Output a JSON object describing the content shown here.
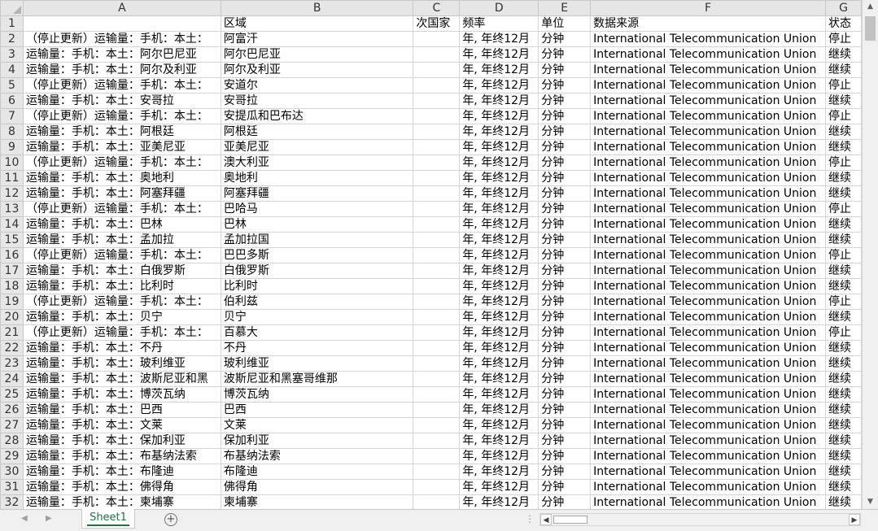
{
  "columns": [
    "A",
    "B",
    "C",
    "D",
    "E",
    "F",
    "G"
  ],
  "header_row": {
    "num": "1",
    "cells": [
      "",
      "区域",
      "次国家",
      "频率",
      "单位",
      "数据来源",
      "状态"
    ]
  },
  "rows": [
    {
      "num": "2",
      "cells": [
        "（停止更新）运输量：手机：本土：",
        "阿富汗",
        "",
        "年, 年终12月",
        "分钟",
        "International Telecommunication Union",
        "停止"
      ]
    },
    {
      "num": "3",
      "cells": [
        "运输量：手机：本土：阿尔巴尼亚",
        "阿尔巴尼亚",
        "",
        "年, 年终12月",
        "分钟",
        "International Telecommunication Union",
        "继续"
      ]
    },
    {
      "num": "4",
      "cells": [
        "运输量：手机：本土：阿尔及利亚",
        "阿尔及利亚",
        "",
        "年, 年终12月",
        "分钟",
        "International Telecommunication Union",
        "继续"
      ]
    },
    {
      "num": "5",
      "cells": [
        "（停止更新）运输量：手机：本土：",
        "安道尔",
        "",
        "年, 年终12月",
        "分钟",
        "International Telecommunication Union",
        "停止"
      ]
    },
    {
      "num": "6",
      "cells": [
        "运输量：手机：本土：安哥拉",
        "安哥拉",
        "",
        "年, 年终12月",
        "分钟",
        "International Telecommunication Union",
        "继续"
      ]
    },
    {
      "num": "7",
      "cells": [
        "（停止更新）运输量：手机：本土：",
        "安提瓜和巴布达",
        "",
        "年, 年终12月",
        "分钟",
        "International Telecommunication Union",
        "停止"
      ]
    },
    {
      "num": "8",
      "cells": [
        "运输量：手机：本土：阿根廷",
        "阿根廷",
        "",
        "年, 年终12月",
        "分钟",
        "International Telecommunication Union",
        "继续"
      ]
    },
    {
      "num": "9",
      "cells": [
        "运输量：手机：本土：亚美尼亚",
        "亚美尼亚",
        "",
        "年, 年终12月",
        "分钟",
        "International Telecommunication Union",
        "继续"
      ]
    },
    {
      "num": "10",
      "cells": [
        "（停止更新）运输量：手机：本土：",
        "澳大利亚",
        "",
        "年, 年终12月",
        "分钟",
        "International Telecommunication Union",
        "停止"
      ]
    },
    {
      "num": "11",
      "cells": [
        "运输量：手机：本土：奥地利",
        "奥地利",
        "",
        "年, 年终12月",
        "分钟",
        "International Telecommunication Union",
        "继续"
      ]
    },
    {
      "num": "12",
      "cells": [
        "运输量：手机：本土：阿塞拜疆",
        "阿塞拜疆",
        "",
        "年, 年终12月",
        "分钟",
        "International Telecommunication Union",
        "继续"
      ]
    },
    {
      "num": "13",
      "cells": [
        "（停止更新）运输量：手机：本土：",
        "巴哈马",
        "",
        "年, 年终12月",
        "分钟",
        "International Telecommunication Union",
        "停止"
      ]
    },
    {
      "num": "14",
      "cells": [
        "运输量：手机：本土：巴林",
        "巴林",
        "",
        "年, 年终12月",
        "分钟",
        "International Telecommunication Union",
        "继续"
      ]
    },
    {
      "num": "15",
      "cells": [
        "运输量：手机：本土：孟加拉",
        "孟加拉国",
        "",
        "年, 年终12月",
        "分钟",
        "International Telecommunication Union",
        "继续"
      ]
    },
    {
      "num": "16",
      "cells": [
        "（停止更新）运输量：手机：本土：",
        "巴巴多斯",
        "",
        "年, 年终12月",
        "分钟",
        "International Telecommunication Union",
        "停止"
      ]
    },
    {
      "num": "17",
      "cells": [
        "运输量：手机：本土：白俄罗斯",
        "白俄罗斯",
        "",
        "年, 年终12月",
        "分钟",
        "International Telecommunication Union",
        "继续"
      ]
    },
    {
      "num": "18",
      "cells": [
        "运输量：手机：本土：比利时",
        "比利时",
        "",
        "年, 年终12月",
        "分钟",
        "International Telecommunication Union",
        "继续"
      ]
    },
    {
      "num": "19",
      "cells": [
        "（停止更新）运输量：手机：本土：",
        "伯利兹",
        "",
        "年, 年终12月",
        "分钟",
        "International Telecommunication Union",
        "停止"
      ]
    },
    {
      "num": "20",
      "cells": [
        "运输量：手机：本土：贝宁",
        "贝宁",
        "",
        "年, 年终12月",
        "分钟",
        "International Telecommunication Union",
        "继续"
      ]
    },
    {
      "num": "21",
      "cells": [
        "（停止更新）运输量：手机：本土：",
        "百慕大",
        "",
        "年, 年终12月",
        "分钟",
        "International Telecommunication Union",
        "停止"
      ]
    },
    {
      "num": "22",
      "cells": [
        "运输量：手机：本土：不丹",
        "不丹",
        "",
        "年, 年终12月",
        "分钟",
        "International Telecommunication Union",
        "继续"
      ]
    },
    {
      "num": "23",
      "cells": [
        "运输量：手机：本土：玻利维亚",
        "玻利维亚",
        "",
        "年, 年终12月",
        "分钟",
        "International Telecommunication Union",
        "继续"
      ]
    },
    {
      "num": "24",
      "cells": [
        "运输量：手机：本土：波斯尼亚和黑",
        "波斯尼亚和黑塞哥维那",
        "",
        "年, 年终12月",
        "分钟",
        "International Telecommunication Union",
        "继续"
      ]
    },
    {
      "num": "25",
      "cells": [
        "运输量：手机：本土：博茨瓦纳",
        "博茨瓦纳",
        "",
        "年, 年终12月",
        "分钟",
        "International Telecommunication Union",
        "继续"
      ]
    },
    {
      "num": "26",
      "cells": [
        "运输量：手机：本土：巴西",
        "巴西",
        "",
        "年, 年终12月",
        "分钟",
        "International Telecommunication Union",
        "继续"
      ]
    },
    {
      "num": "27",
      "cells": [
        "运输量：手机：本土：文莱",
        "文莱",
        "",
        "年, 年终12月",
        "分钟",
        "International Telecommunication Union",
        "继续"
      ]
    },
    {
      "num": "28",
      "cells": [
        "运输量：手机：本土：保加利亚",
        "保加利亚",
        "",
        "年, 年终12月",
        "分钟",
        "International Telecommunication Union",
        "继续"
      ]
    },
    {
      "num": "29",
      "cells": [
        "运输量：手机：本土：布基纳法索",
        "布基纳法索",
        "",
        "年, 年终12月",
        "分钟",
        "International Telecommunication Union",
        "继续"
      ]
    },
    {
      "num": "30",
      "cells": [
        "运输量：手机：本土：布隆迪",
        "布隆迪",
        "",
        "年, 年终12月",
        "分钟",
        "International Telecommunication Union",
        "继续"
      ]
    },
    {
      "num": "31",
      "cells": [
        "运输量：手机：本土：佛得角",
        "佛得角",
        "",
        "年, 年终12月",
        "分钟",
        "International Telecommunication Union",
        "继续"
      ]
    },
    {
      "num": "32",
      "cells": [
        "运输量：手机：本土：柬埔寨",
        "柬埔寨",
        "",
        "年, 年终12月",
        "分钟",
        "International Telecommunication Union",
        "继续"
      ]
    }
  ],
  "sheet_tabs": [
    {
      "label": "Sheet1",
      "active": true
    }
  ],
  "add_sheet_symbol": "+",
  "ellipsis_symbol": "⋮",
  "colors": {
    "accent": "#217346",
    "header_bg": "#e6e6e6",
    "gridline": "#d4d4d4"
  },
  "icons": {
    "scroll_up": "up-arrow-icon",
    "scroll_down": "down-arrow-icon",
    "scroll_left": "left-arrow-icon",
    "scroll_right": "right-arrow-icon",
    "add_sheet": "plus-circle-icon"
  }
}
